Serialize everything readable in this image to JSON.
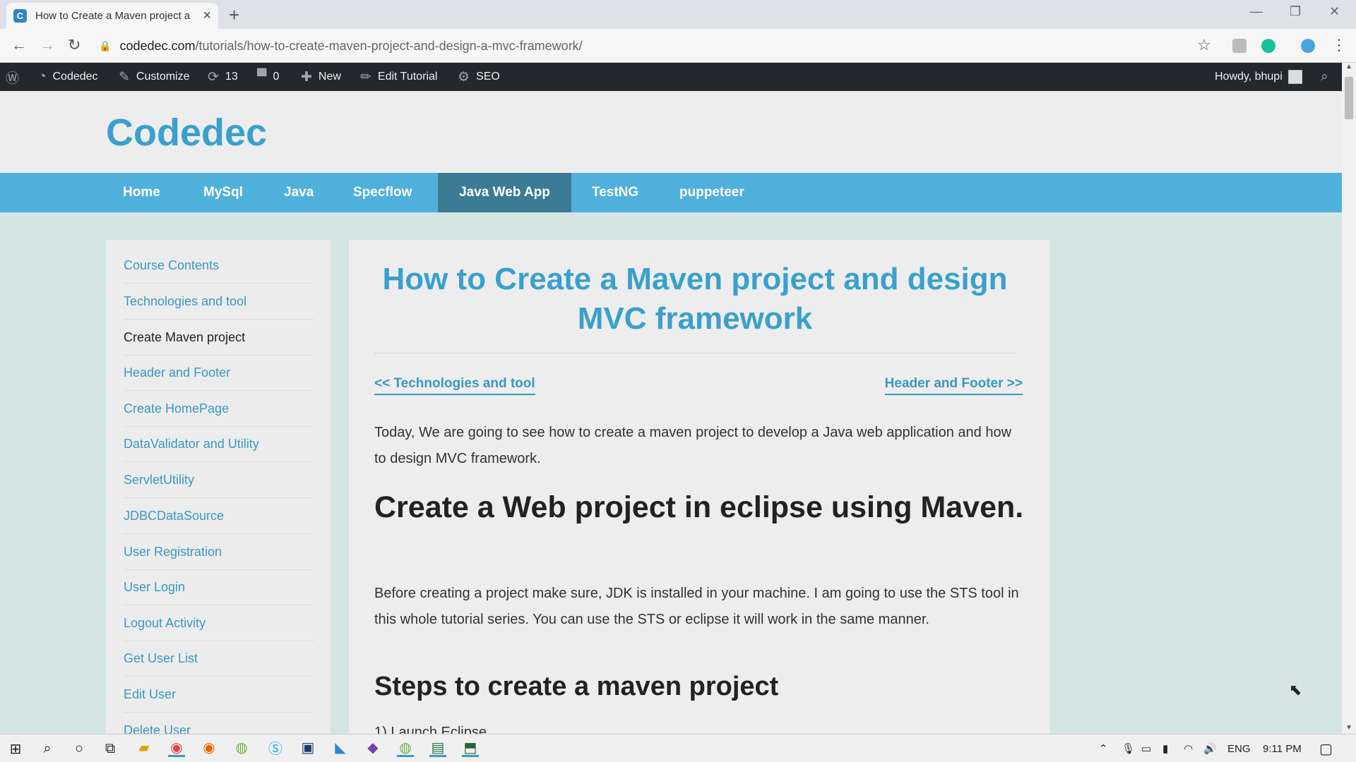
{
  "browser": {
    "tab_title": "How to Create a Maven project a",
    "favicon_letter": "C",
    "url_host": "codedec.com",
    "url_path": "/tutorials/how-to-create-maven-project-and-design-a-mvc-framework/"
  },
  "adminbar": {
    "items": [
      {
        "icon": "wordpress-icon",
        "label": ""
      },
      {
        "icon": "dashboard-icon",
        "label": "Codedec"
      },
      {
        "icon": "brush-icon",
        "label": "Customize"
      },
      {
        "icon": "updates-icon",
        "label": "13"
      },
      {
        "icon": "comment-icon",
        "label": "0"
      },
      {
        "icon": "plus-icon",
        "label": "New"
      },
      {
        "icon": "pencil-icon",
        "label": "Edit Tutorial"
      },
      {
        "icon": "gear-icon",
        "label": "SEO"
      }
    ],
    "howdy": "Howdy, bhupi"
  },
  "site": {
    "title": "Codedec"
  },
  "nav": {
    "items": [
      "Home",
      "MySql",
      "Java",
      "Specflow",
      "Java Web App",
      "TestNG",
      "puppeteer"
    ],
    "active": "Java Web App"
  },
  "sidebar": {
    "items": [
      "Course Contents",
      "Technologies and tool",
      "Create Maven project",
      "Header and Footer",
      "Create HomePage",
      "DataValidator and Utility",
      "ServletUtility",
      "JDBCDataSource",
      "User Registration",
      "User Login",
      "Logout Activity",
      "Get User List",
      "Edit User",
      "Delete User"
    ],
    "current": "Create Maven project"
  },
  "article": {
    "title": "How to Create a Maven project and design MVC framework",
    "prev": "<< Technologies and tool",
    "next": "Header and Footer >>",
    "intro": "Today, We are going to see how to create a maven project to develop a Java web application and how to design MVC framework.",
    "h2": "Create a Web project in eclipse using Maven.",
    "para2": "Before creating a project make sure, JDK is installed in your machine. I am going to use the STS tool in this whole tutorial series. You can use the STS or eclipse it will work in the same manner.",
    "h3": "Steps to create a maven project",
    "step1": "1) Launch Eclipse"
  },
  "taskbar": {
    "language": "ENG",
    "time": "9:11 PM"
  },
  "colors": {
    "brand": "#3aa0cd",
    "nav_bg": "#4fb0dc",
    "nav_active": "#3b7b94",
    "adminbar": "#23282d"
  }
}
